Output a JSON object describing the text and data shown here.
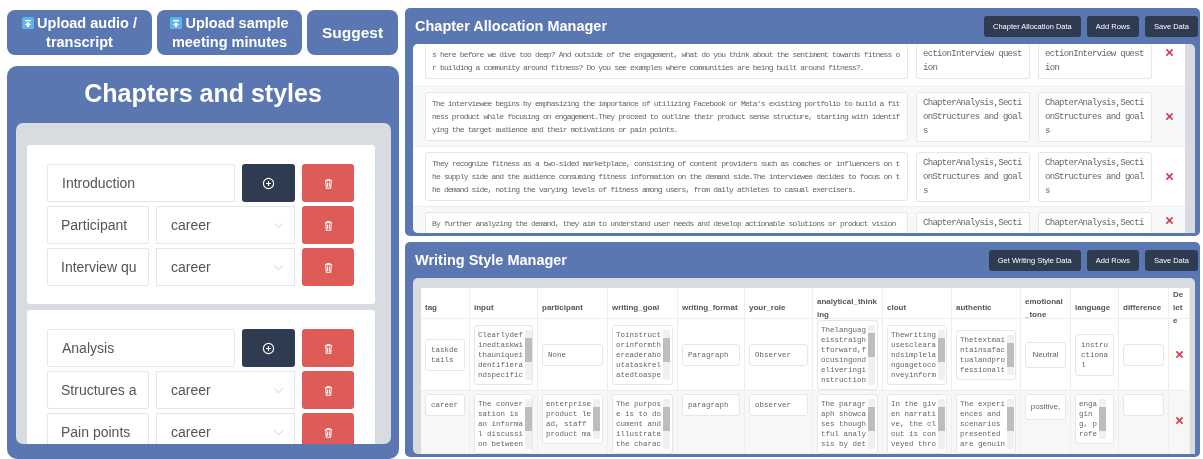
{
  "toolbar": [
    {
      "label": "Upload audio / transcript",
      "kind": "upload"
    },
    {
      "label": "Upload sample meeting minutes",
      "kind": "upload"
    },
    {
      "label": "Suggest",
      "kind": "plain"
    }
  ],
  "chapters_panel": {
    "title": "Chapters and styles",
    "chapters": [
      {
        "name": "Introduction",
        "sections": [
          {
            "name": "Participant",
            "style": "career"
          },
          {
            "name": "Interview qu",
            "style": "career"
          }
        ]
      },
      {
        "name": "Analysis",
        "sections": [
          {
            "name": "Structures a",
            "style": "career"
          },
          {
            "name": "Pain points",
            "style": "career"
          }
        ]
      }
    ]
  },
  "chapter_allocation": {
    "title": "Chapter Allocation Manager",
    "buttons": [
      "Chapter Allocation Data",
      "Add Rows",
      "Save Data"
    ],
    "rows": [
      {
        "text": "s here before we dive too deep? And outside of the engagement, what do you think about the sentiment towards fitness or building a community around fitness? Do you see examples where communities are being built around fitness?.",
        "column_2": "ectionInterview question",
        "column_3": "ectionInterview question"
      },
      {
        "text": "The interviewee begins by emphasizing the importance of utilizing Facebook or Meta's existing portfolio to build a fitness product while focusing on engagement.They proceed to outline their product sense structure, starting with identifying the target audience and their motivations or pain points.",
        "column_2": "ChapterAnalysis,SectionStructures and goals",
        "column_3": "ChapterAnalysis,SectionStructures and goals"
      },
      {
        "text": "They recognize fitness as a two-sided marketplace, consisting of content providers such as coaches or influencers on the supply side and the audience consuming fitness information on the demand side.The interviewee decides to focus on the demand side, noting the varying levels of fitness among users, from daily athletes to casual exercisers.",
        "column_2": "ChapterAnalysis,SectionStructures and goals",
        "column_3": "ChapterAnalysis,SectionStructures and goals"
      },
      {
        "text": "By further analyzing the demand, they aim to understand user needs and develop actionable solutions or product vision",
        "column_2": "ChapterAnalysis,Secti",
        "column_3": "ChapterAnalysis,Secti"
      }
    ]
  },
  "writing_style": {
    "title": "Writing Style Manager",
    "buttons": [
      "Get Writing Style Data",
      "Add Rows",
      "Save Data"
    ],
    "columns": [
      "tag",
      "input",
      "participant",
      "writing_goal",
      "writing_format",
      "your_role",
      "analytical_thinking",
      "clout",
      "authentic",
      "emotional_tone",
      "language",
      "difference",
      "Delete"
    ],
    "rows": [
      {
        "cells": [
          {
            "kind": "field",
            "value": "taskdetails"
          },
          {
            "kind": "scroll",
            "value": "Clearlydefinedtaskwithauniqueidentifierandspecific"
          },
          {
            "kind": "field",
            "value": "None"
          },
          {
            "kind": "scroll",
            "value": "Toinstructorinformthereaderaboutataskrelatedtoaspe"
          },
          {
            "kind": "field",
            "value": "Paragraph"
          },
          {
            "kind": "field",
            "value": "Observer"
          },
          {
            "kind": "scroll",
            "value": "Thelanguageisstraightforward,focusingondeliveringinstruction"
          },
          {
            "kind": "scroll",
            "value": "Thewritingusesclearandsimplelanguagetoconveyinform"
          },
          {
            "kind": "scroll",
            "value": "Thetextmaintainsafactualandprofessionalt"
          },
          {
            "kind": "tone",
            "value": "Neutral"
          },
          {
            "kind": "field",
            "value": "instructional"
          },
          {
            "kind": "field"
          }
        ]
      },
      {
        "cells": [
          {
            "kind": "field",
            "value": "career"
          },
          {
            "kind": "scroll",
            "value": "The conversation is an informal discussion between"
          },
          {
            "kind": "scroll",
            "value": "enterprise product lead, staff product ma"
          },
          {
            "kind": "scroll",
            "value": "The purpose is to document and illustrate the charac"
          },
          {
            "kind": "field",
            "value": "paragraph"
          },
          {
            "kind": "field",
            "value": "observer"
          },
          {
            "kind": "scroll",
            "value": "The paragraph showcases thoughtful analysis by det"
          },
          {
            "kind": "scroll",
            "value": "In the given narrative, the clout is conveyed thro"
          },
          {
            "kind": "scroll",
            "value": "The experiences and scenarios presented are genuin"
          },
          {
            "kind": "tone",
            "value": "positive,"
          },
          {
            "kind": "scroll",
            "value": "engaging, profe"
          },
          {
            "kind": "field"
          }
        ]
      }
    ]
  }
}
